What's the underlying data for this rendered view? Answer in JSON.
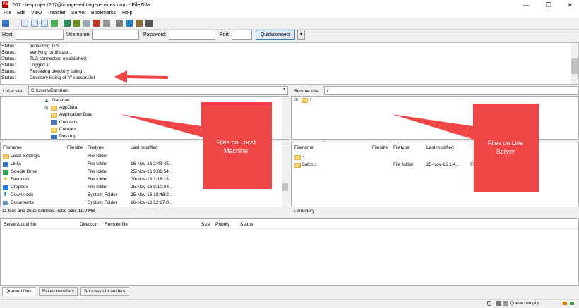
{
  "window": {
    "title": "207 - iesproject207@image-editing-services.com - FileZilla",
    "app_icon_text": "Fz",
    "minimize": "—",
    "maximize": "❐",
    "close": "✕"
  },
  "menu": [
    "File",
    "Edit",
    "View",
    "Transfer",
    "Server",
    "Bookmarks",
    "Help"
  ],
  "quickconnect": {
    "host_label": "Host:",
    "username_label": "Username:",
    "password_label": "Password:",
    "port_label": "Port:",
    "host_value": "",
    "username_value": "",
    "password_value": "",
    "port_value": "",
    "button": "Quickconnect",
    "dropdown": "▾"
  },
  "log": [
    {
      "status": "Status:",
      "message": "Initializing TLS..."
    },
    {
      "status": "Status:",
      "message": "Verifying certificate..."
    },
    {
      "status": "Status:",
      "message": "TLS connection established."
    },
    {
      "status": "Status:",
      "message": "Logged in"
    },
    {
      "status": "Status:",
      "message": "Retrieving directory listing..."
    },
    {
      "status": "Status:",
      "message": "Directory listing of \"/\" successful"
    }
  ],
  "local": {
    "site_label": "Local site:",
    "site_path": "C:\\Users\\Darshan\\",
    "tree": [
      "Darshan",
      "AppData",
      "Application Data",
      "Contacts",
      "Cookies",
      "Desktop"
    ],
    "headers": {
      "filename": "Filename",
      "filesize": "Filesize",
      "filetype": "Filetype",
      "modified": "Last modified"
    },
    "files": [
      {
        "name": "Local Settings",
        "type": "File folder",
        "modified": ""
      },
      {
        "name": "Links",
        "type": "File folder",
        "modified": "16-Nov-16 3:43:45..."
      },
      {
        "name": "Google Drive",
        "type": "File folder",
        "modified": "25-Nov-16 9:09:54..."
      },
      {
        "name": "Favorites",
        "type": "File folder",
        "modified": "09-Nov-16 2:18:23..."
      },
      {
        "name": "Dropbox",
        "type": "File folder",
        "modified": "25-Nov-16 9:10:03..."
      },
      {
        "name": "Downloads",
        "type": "System Folder",
        "modified": "25-Nov-16 10:48:2..."
      },
      {
        "name": "Documents",
        "type": "System Folder",
        "modified": "16-Nov-16 12:27:0..."
      }
    ],
    "summary": "11 files and 26 directories. Total size: 11.9 MB"
  },
  "remote": {
    "site_label": "Remote site:",
    "site_path": "/",
    "tree": [
      "/"
    ],
    "headers": {
      "filename": "Filename",
      "filesize": "Filesize",
      "filetype": "Filetype",
      "modified": "Last modified"
    },
    "files": [
      {
        "name": "..",
        "type": "",
        "modified": ""
      },
      {
        "name": "Batch 1",
        "type": "File folder",
        "modified": "25-Nov-16 1:4..."
      }
    ],
    "partial_column": "07",
    "summary": "1 directory"
  },
  "queue": {
    "headers": {
      "server_file": "Server/Local file",
      "direction": "Direction",
      "remote_file": "Remote file",
      "size": "Size",
      "priority": "Priority",
      "status": "Status"
    },
    "tabs": [
      "Queued files",
      "Failed transfers",
      "Successful transfers"
    ],
    "status": "Queue: empty"
  },
  "annotations": {
    "local_callout": "Files on Local Machine",
    "remote_callout": "Files on Live Server",
    "color": "#f04648"
  }
}
